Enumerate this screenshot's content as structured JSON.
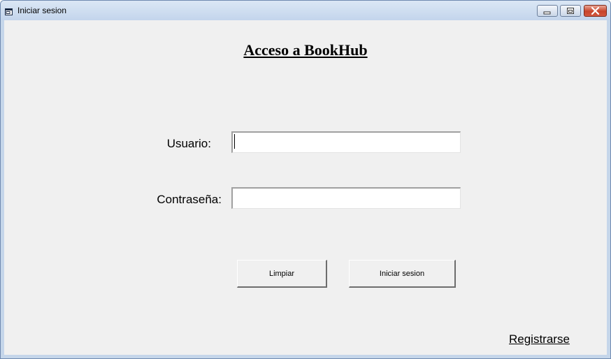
{
  "window": {
    "title": "Iniciar sesion",
    "icon": "form-window-icon"
  },
  "controls": {
    "minimize_icon": "minimize-icon",
    "maximize_icon": "restore-icon",
    "close_icon": "close-icon",
    "close_color": "#c7442b"
  },
  "form": {
    "heading": "Acceso a BookHub",
    "user_label": "Usuario:",
    "user_value": "",
    "password_label": "Contraseña:",
    "password_value": "",
    "clear_button": "Limpiar",
    "login_button": "Iniciar sesion",
    "register_link": "Registrarse"
  },
  "colors": {
    "client_background": "#f0f0f0",
    "titlebar": "#c3d5ec"
  }
}
